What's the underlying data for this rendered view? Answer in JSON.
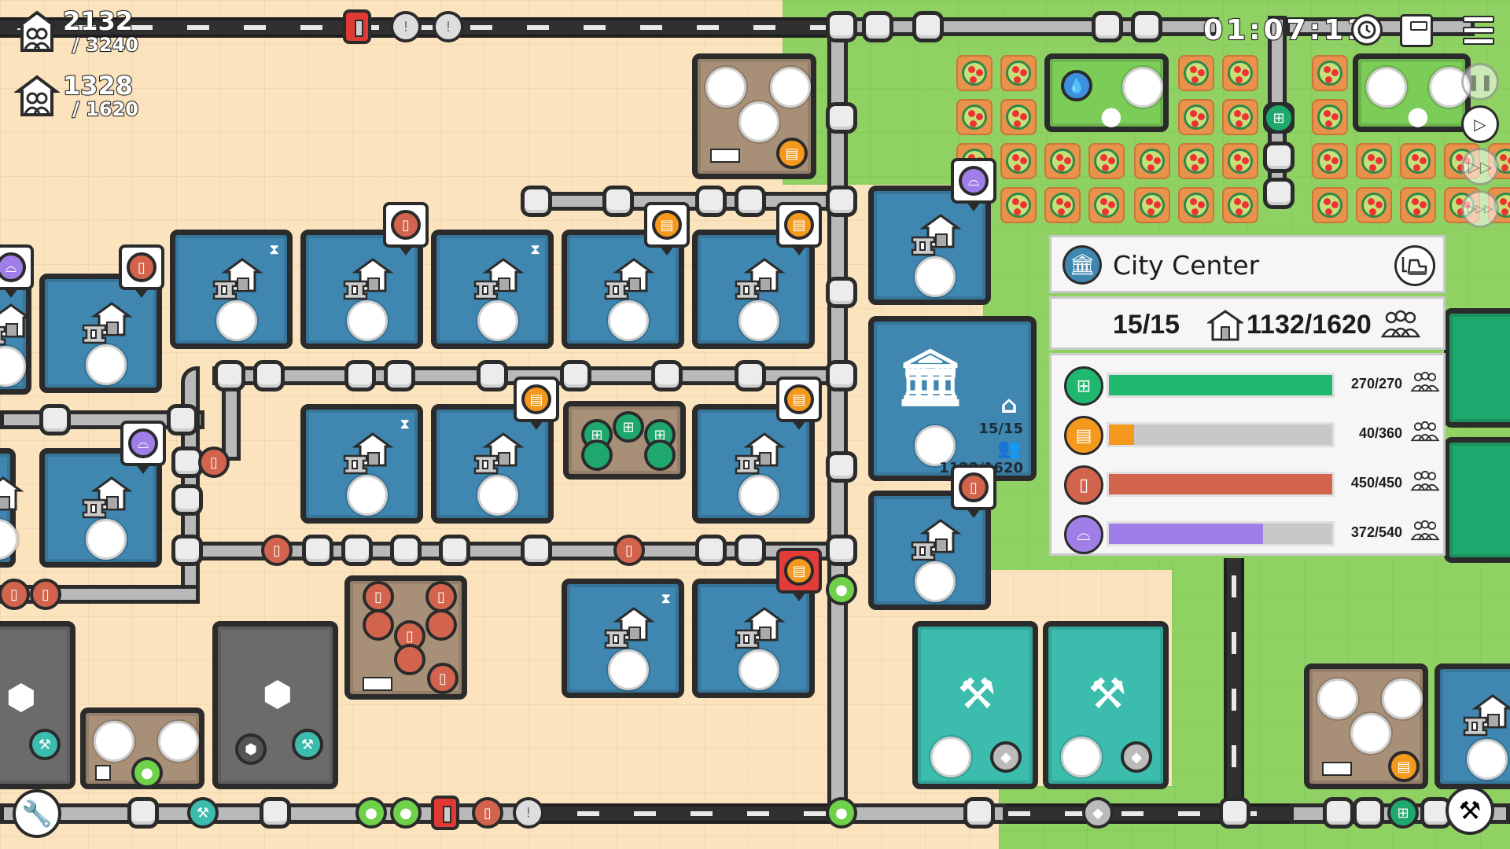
{
  "hud": {
    "total_population": "2132",
    "total_capacity": "/ 3240",
    "housed_population": "1328",
    "housed_capacity": "/ 1620",
    "timer": "01:07:11"
  },
  "controls": {
    "pause": "pause",
    "play": "play",
    "fast_forward": "fast-forward",
    "fastest_forward": "fastest-forward"
  },
  "city_center_panel": {
    "title": "City Center",
    "houses": "15/15",
    "population": "1132/1620",
    "needs": [
      {
        "resource": "barrel",
        "value": "270/270",
        "fraction": 1.0,
        "color": "#20b86f"
      },
      {
        "resource": "bread",
        "value": "40/360",
        "fraction": 0.111,
        "color": "#f4981e"
      },
      {
        "resource": "paper",
        "value": "450/450",
        "fraction": 1.0,
        "color": "#d2644e"
      },
      {
        "resource": "furniture",
        "value": "372/540",
        "fraction": 0.689,
        "color": "#a07ee8"
      }
    ]
  },
  "city_center_building": {
    "houses": "15/15",
    "population": "1132/1620"
  },
  "colors": {
    "sand": "#fbe3bd",
    "grass": "#8fd163",
    "house": "#3f87b0",
    "storage": "#a89078",
    "workshop": "#3bbcad",
    "quarry": "#6b6b6b",
    "barrel_factory": "#1fa86d",
    "alert": "#e43b3b"
  }
}
